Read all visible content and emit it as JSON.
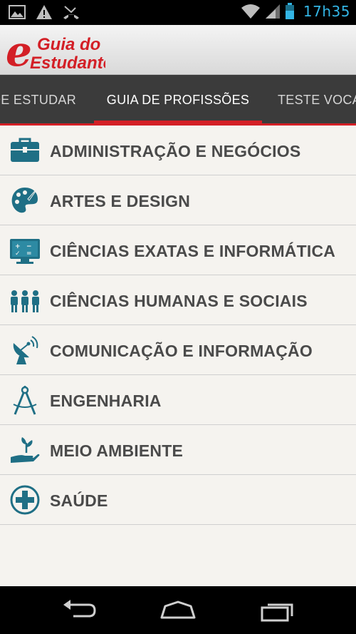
{
  "status_bar": {
    "time": "17h35",
    "time_color": "#33b5e5",
    "left_icons": [
      "image-icon",
      "warning-icon",
      "missed-call-icon"
    ],
    "right_icons": [
      "wifi-icon",
      "signal-icon",
      "battery-icon"
    ]
  },
  "header": {
    "logo_letter": "e",
    "logo_line1": "Guia do",
    "logo_line2": "Estudante",
    "brand_color": "#d31f26"
  },
  "tabs": [
    {
      "label": "DE ESTUDAR",
      "active": false
    },
    {
      "label": "GUIA DE PROFISSÕES",
      "active": true
    },
    {
      "label": "TESTE VOCA",
      "active": false
    }
  ],
  "categories": [
    {
      "label": "ADMINISTRAÇÃO E NEGÓCIOS",
      "icon": "briefcase-icon"
    },
    {
      "label": "ARTES E DESIGN",
      "icon": "palette-icon"
    },
    {
      "label": "CIÊNCIAS EXATAS E INFORMÁTICA",
      "icon": "monitor-math-icon"
    },
    {
      "label": "CIÊNCIAS HUMANAS E SOCIAIS",
      "icon": "people-icon"
    },
    {
      "label": "COMUNICAÇÃO E INFORMAÇÃO",
      "icon": "satellite-dish-icon"
    },
    {
      "label": "ENGENHARIA",
      "icon": "compass-icon"
    },
    {
      "label": "MEIO AMBIENTE",
      "icon": "plant-hand-icon"
    },
    {
      "label": "SAÚDE",
      "icon": "plus-circle-icon"
    }
  ],
  "icon_color": "#1f6f85",
  "nav_bar": {
    "buttons": [
      "back-icon",
      "home-icon",
      "recents-icon"
    ]
  }
}
